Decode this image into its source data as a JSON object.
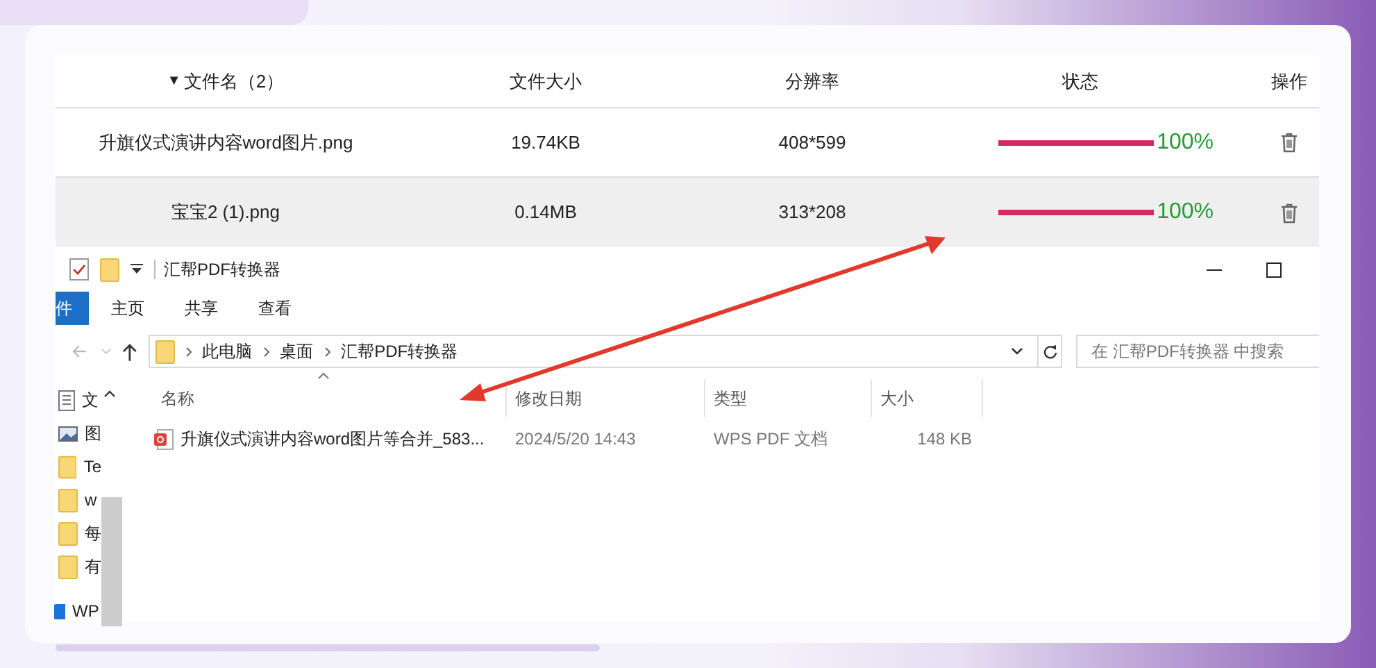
{
  "table": {
    "columns": [
      {
        "label": "文件名（2）",
        "sort_mark": "▼"
      },
      {
        "label": "文件大小"
      },
      {
        "label": "分辨率"
      },
      {
        "label": "状态"
      },
      {
        "label": "操作"
      }
    ],
    "rows": [
      {
        "name": "升旗仪式演讲内容word图片.png",
        "size": "19.74KB",
        "resolution": "408*599",
        "level": 1,
        "reading": "100%",
        "selected": false
      },
      {
        "name": "宝宝2 (1).png",
        "size": "0.14MB",
        "resolution": "313*208",
        "level": 1,
        "reading": "100%",
        "selected": true
      }
    ]
  },
  "explorer": {
    "title": "汇帮PDF转换器",
    "ribbon_tabs": [
      {
        "label": "件",
        "kind": "file"
      },
      {
        "label": "主页",
        "kind": "tab"
      },
      {
        "label": "共享",
        "kind": "tab"
      },
      {
        "label": "查看",
        "kind": "tab"
      }
    ],
    "address": [
      "此电脑",
      "桌面",
      "汇帮PDF转换器"
    ],
    "search": {
      "placeholder": "在 汇帮PDF转换器 中搜索"
    },
    "nav_items": [
      {
        "kind": "document",
        "label": "文"
      },
      {
        "kind": "images",
        "label": "图"
      },
      {
        "kind": "folder",
        "label": "Te"
      },
      {
        "kind": "folder",
        "label": "w"
      },
      {
        "kind": "folder",
        "label": "每"
      },
      {
        "kind": "folder",
        "label": "有"
      },
      {
        "kind": "cloud",
        "label": "WP"
      }
    ],
    "columns": [
      "名称",
      "修改日期",
      "类型",
      "大小"
    ],
    "files": [
      {
        "name": "升旗仪式演讲内容word图片等合并_583...",
        "modified": "2024/5/20 14:43",
        "type": "WPS PDF 文档",
        "size": "148 KB"
      }
    ]
  }
}
